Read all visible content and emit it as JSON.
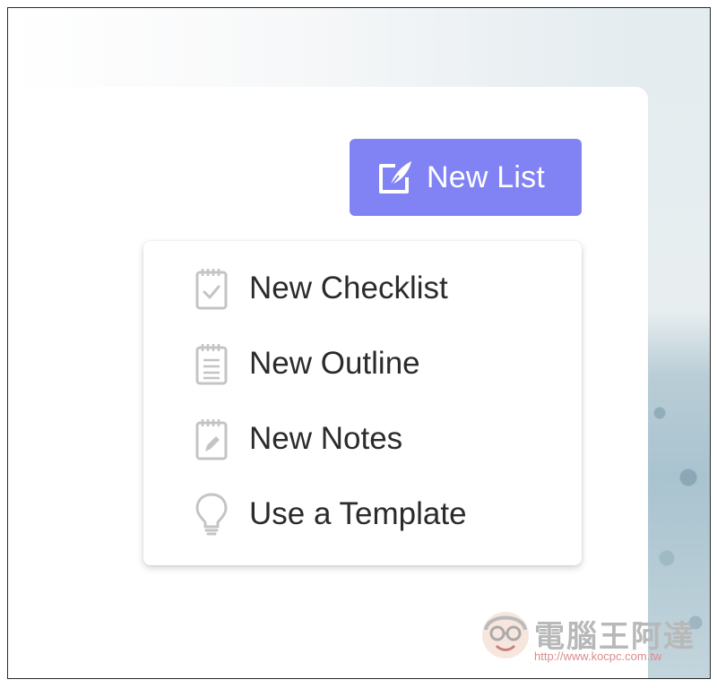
{
  "new_list_button": {
    "label": "New List",
    "icon": "edit-note-icon",
    "color": "#8183f4"
  },
  "menu": {
    "items": [
      {
        "label": "New Checklist",
        "icon": "checklist-icon"
      },
      {
        "label": "New Outline",
        "icon": "outline-icon"
      },
      {
        "label": "New Notes",
        "icon": "notes-icon"
      },
      {
        "label": "Use a Template",
        "icon": "lightbulb-icon"
      }
    ]
  },
  "watermark": {
    "title": "電腦王阿達",
    "url": "http://www.kocpc.com.tw"
  }
}
